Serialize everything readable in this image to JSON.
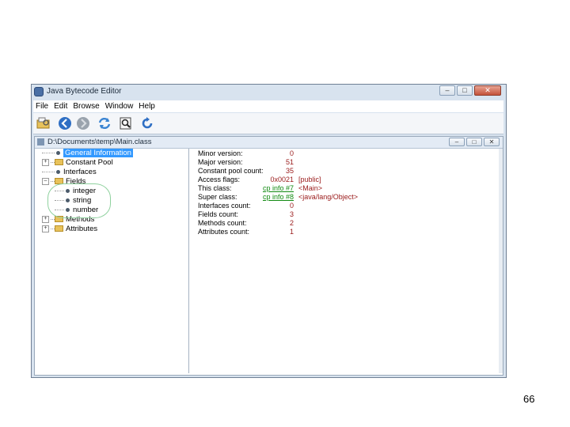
{
  "window": {
    "title": "Java Bytecode Editor",
    "controls": [
      "–",
      "□",
      "✕"
    ]
  },
  "menu": [
    "File",
    "Edit",
    "Browse",
    "Window",
    "Help"
  ],
  "toolbar": [
    {
      "icon": "open-folder-icon"
    },
    {
      "icon": "back-arrow-icon",
      "color": "#2f6fc4"
    },
    {
      "icon": "forward-arrow-icon",
      "color": "#9aa3ad"
    },
    {
      "icon": "refresh-icon",
      "color": "#3a84d2"
    },
    {
      "icon": "inspect-icon"
    },
    {
      "icon": "reload-icon",
      "color": "#2f6fc4"
    }
  ],
  "document": {
    "title": "D:\\Documents\\temp\\Main.class",
    "controls": [
      "–",
      "□",
      "✕"
    ]
  },
  "tree": [
    {
      "label": "General Information",
      "kind": "leaf",
      "selected": true
    },
    {
      "label": "Constant Pool",
      "kind": "folder",
      "expand": "+"
    },
    {
      "label": "Interfaces",
      "kind": "leaf"
    },
    {
      "label": "Fields",
      "kind": "folder",
      "expand": "–"
    },
    {
      "label": "integer",
      "kind": "child"
    },
    {
      "label": "string",
      "kind": "child"
    },
    {
      "label": "number",
      "kind": "child"
    },
    {
      "label": "Methods",
      "kind": "folder",
      "expand": "+"
    },
    {
      "label": "Attributes",
      "kind": "folder",
      "expand": "+"
    }
  ],
  "properties": [
    {
      "name": "Minor version:",
      "value": "0"
    },
    {
      "name": "Major version:",
      "value": "51"
    },
    {
      "name": "Constant pool count:",
      "value": "35"
    },
    {
      "name": "Access flags:",
      "value": "0x0021",
      "extra": "[public]"
    },
    {
      "name": "This class:",
      "value": "cp info #7",
      "link": true,
      "extra": "<Main>"
    },
    {
      "name": "Super class:",
      "value": "cp info #8",
      "link": true,
      "extra": "<java/lang/Object>"
    },
    {
      "name": "Interfaces count:",
      "value": "0"
    },
    {
      "name": "Fields count:",
      "value": "3"
    },
    {
      "name": "Methods count:",
      "value": "2"
    },
    {
      "name": "Attributes count:",
      "value": "1"
    }
  ],
  "page_number": "66"
}
